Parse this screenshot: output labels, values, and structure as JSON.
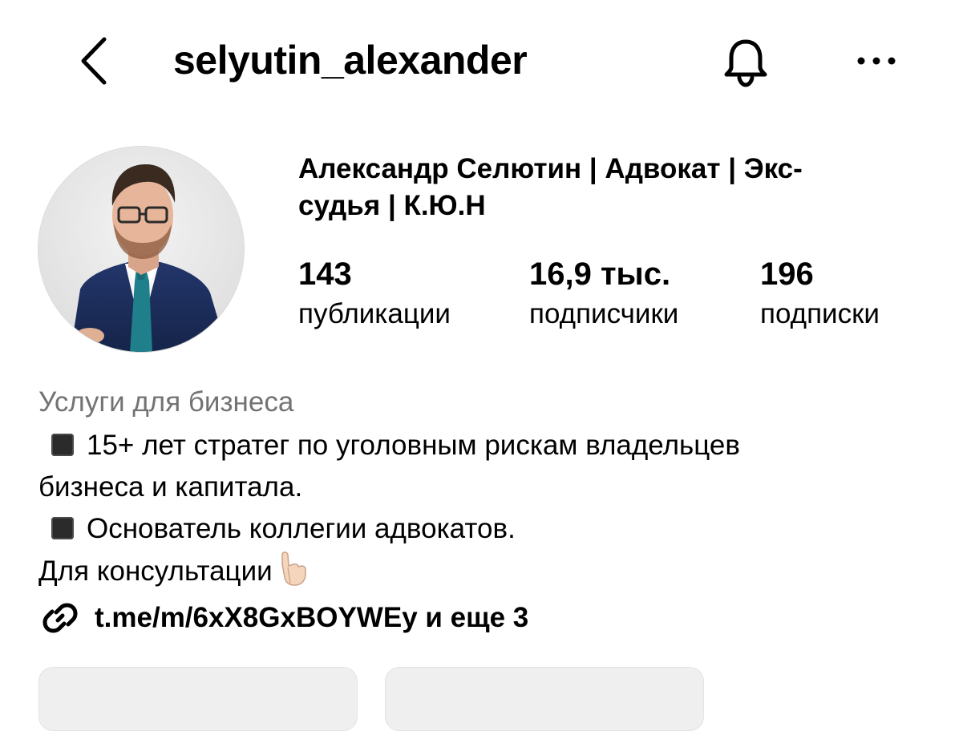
{
  "header": {
    "username": "selyutin_alexander",
    "back_icon": "chevron-left-icon",
    "bell_icon": "bell-icon",
    "more_icon": "more-horizontal-icon"
  },
  "profile": {
    "full_name": "Александр Селютин | Адвокат | Экс-\nсудья | К.Ю.Н",
    "stats": {
      "posts": {
        "count": "143",
        "label": "публикации"
      },
      "followers": {
        "count": "16,9 тыс.",
        "label": "подписчики"
      },
      "following": {
        "count": "196",
        "label": "подписки"
      }
    }
  },
  "bio": {
    "category": "Услуги для бизнеса",
    "line1": "15+ лет стратег по уголовным рискам владельцев",
    "line2": "бизнеса и капитала.",
    "line3": "Основатель коллегии адвокатов.",
    "line4": "Для консультации",
    "link_text": "t.me/m/6xX8GxBOYWEy и еще 3"
  },
  "colors": {
    "text": "#000000",
    "secondary_text": "#737373",
    "button_bg": "#efefef",
    "divider": "#dbdbdb"
  }
}
